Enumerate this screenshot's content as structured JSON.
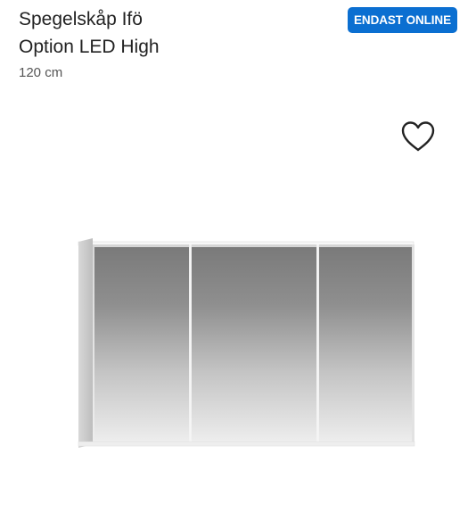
{
  "product": {
    "title_line1": "Spegelskåp Ifö",
    "title_line2": "Option LED High",
    "size": "120 cm",
    "badge": "ENDAST ONLINE",
    "badge_color": "#0b6fd1",
    "favorite_icon": "heart-outline-icon",
    "image_alt": "mirror cabinet"
  }
}
